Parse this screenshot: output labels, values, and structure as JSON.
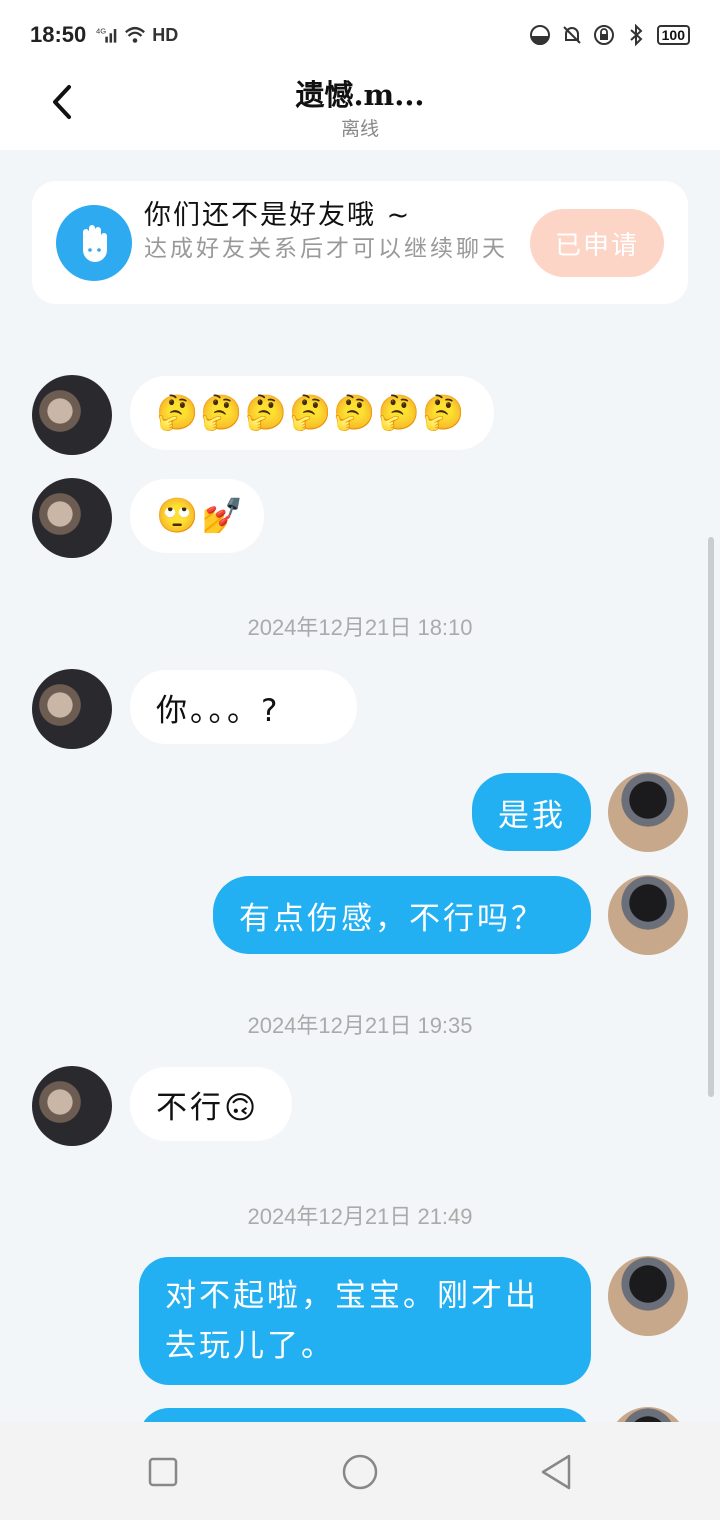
{
  "status_bar": {
    "time": "18:50",
    "network": "4G",
    "wifi_label": "HD",
    "battery": "100"
  },
  "header": {
    "title": "遗憾.m...",
    "subtitle": "离线"
  },
  "friend_notice": {
    "title": "你们还不是好友哦 ~",
    "description": "达成好友关系后才可以继续聊天",
    "button_label": "已申请"
  },
  "timestamps": [
    "2024年12月21日 18:10",
    "2024年12月21日 19:35",
    "2024年12月21日 21:49"
  ],
  "messages": [
    {
      "from": "other",
      "text": "🤔🤔🤔🤔🤔🤔🤔"
    },
    {
      "from": "other",
      "text": "🙄💅"
    },
    {
      "from": "other",
      "text": "你。。。?"
    },
    {
      "from": "me",
      "text": "是我"
    },
    {
      "from": "me",
      "text": "有点伤感，不行吗？"
    },
    {
      "from": "other",
      "text": "不行🙃"
    },
    {
      "from": "me",
      "text": "对不起啦，宝宝。刚才出去玩儿了。"
    }
  ],
  "colors": {
    "accent": "#22b0f3",
    "applied_button": "#fdd5c6",
    "background": "#f3f6f8"
  }
}
